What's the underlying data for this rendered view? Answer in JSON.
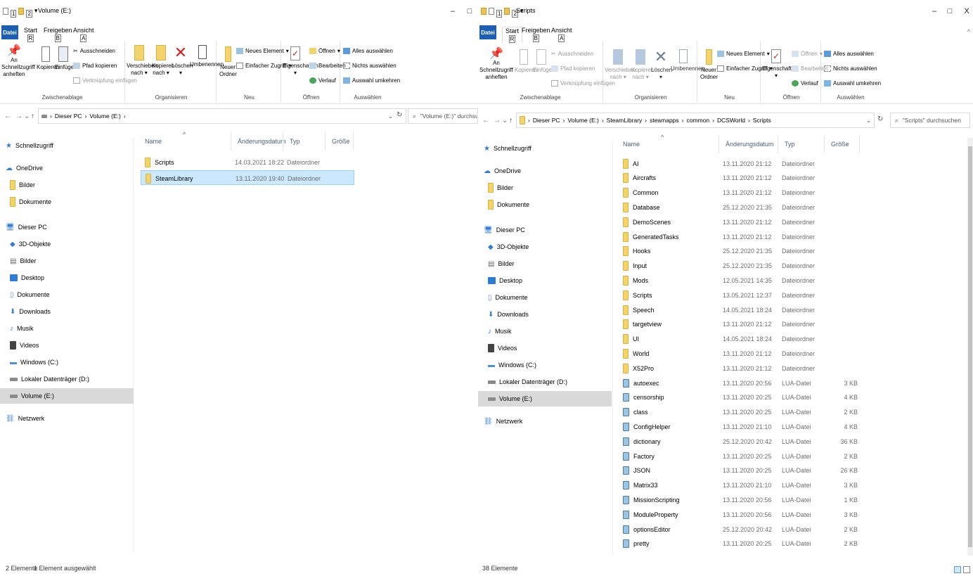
{
  "left": {
    "title": "Volume (E:)",
    "kt1": "1",
    "kt2": "2",
    "file_tab": "Datei",
    "tabs": [
      {
        "label": "Start",
        "key": "R"
      },
      {
        "label": "Freigeben",
        "key": "B"
      },
      {
        "label": "Ansicht",
        "key": "A"
      }
    ],
    "ribbon": {
      "pin": "An Schnellzugriff anheften",
      "copy": "Kopieren",
      "paste": "Einfügen",
      "cut": "Ausschneiden",
      "copy_path": "Pfad kopieren",
      "paste_link": "Verknüpfung einfügen",
      "g_clipboard": "Zwischenablage",
      "move": "Verschieben nach",
      "copyto": "Kopieren nach",
      "delete": "Löschen",
      "rename": "Umbenennen",
      "g_organize": "Organisieren",
      "new_folder": "Neuer Ordner",
      "new_item": "Neues Element",
      "easy_access": "Einfacher Zugriff",
      "g_new": "Neu",
      "properties": "Eigenschaften",
      "open": "Öffnen",
      "edit": "Bearbeiten",
      "history": "Verlauf",
      "g_open": "Öffnen",
      "select_all": "Alles auswählen",
      "select_none": "Nichts auswählen",
      "invert": "Auswahl umkehren",
      "g_select": "Auswählen"
    },
    "path": [
      "Dieser PC",
      "Volume (E:)"
    ],
    "search_placeholder": "\"Volume (E:)\" durchsuchen",
    "sidebar": [
      "Schnellzugriff",
      "OneDrive",
      "Bilder",
      "Dokumente",
      "Dieser PC",
      "3D-Objekte",
      "Bilder",
      "Desktop",
      "Dokumente",
      "Downloads",
      "Musik",
      "Videos",
      "Windows (C:)",
      "Lokaler Datenträger (D:)",
      "Volume (E:)",
      "Netzwerk"
    ],
    "columns": {
      "name": "Name",
      "date": "Änderungsdatum",
      "type": "Typ",
      "size": "Größe"
    },
    "rows": [
      {
        "name": "Scripts",
        "date": "14.03.2021 18:22",
        "type": "Dateiordner",
        "size": ""
      },
      {
        "name": "SteamLibrary",
        "date": "13.11.2020 19:40",
        "type": "Dateiordner",
        "size": ""
      }
    ],
    "status": "2 Elemente",
    "status_sel": "1 Element ausgewählt"
  },
  "right": {
    "title": "Scripts",
    "kt1": "1",
    "kt2": "2",
    "file_tab": "Datei",
    "tabs": [
      {
        "label": "Start",
        "key": "R"
      },
      {
        "label": "Freigeben",
        "key": "B"
      },
      {
        "label": "Ansicht",
        "key": "A"
      }
    ],
    "ribbon": {
      "pin": "An Schnellzugriff anheften",
      "copy": "Kopieren",
      "paste": "Einfügen",
      "cut": "Ausschneiden",
      "copy_path": "Pfad kopieren",
      "paste_link": "Verknüpfung einfügen",
      "g_clipboard": "Zwischenablage",
      "move": "Verschieben nach",
      "copyto": "Kopieren nach",
      "delete": "Löschen",
      "rename": "Umbenennen",
      "g_organize": "Organisieren",
      "new_folder": "Neuer Ordner",
      "new_item": "Neues Element",
      "easy_access": "Einfacher Zugriff",
      "g_new": "Neu",
      "properties": "Eigenschaften",
      "open": "Öffnen",
      "edit": "Bearbeiten",
      "history": "Verlauf",
      "g_open": "Öffnen",
      "select_all": "Alles auswählen",
      "select_none": "Nichts auswählen",
      "invert": "Auswahl umkehren",
      "g_select": "Auswählen"
    },
    "path": [
      "Dieser PC",
      "Volume (E:)",
      "SteamLibrary",
      "steamapps",
      "common",
      "DCSWorld",
      "Scripts"
    ],
    "search_placeholder": "\"Scripts\" durchsuchen",
    "sidebar": [
      "Schnellzugriff",
      "OneDrive",
      "Bilder",
      "Dokumente",
      "Dieser PC",
      "3D-Objekte",
      "Bilder",
      "Desktop",
      "Dokumente",
      "Downloads",
      "Musik",
      "Videos",
      "Windows (C:)",
      "Lokaler Datenträger (D:)",
      "Volume (E:)",
      "Netzwerk"
    ],
    "columns": {
      "name": "Name",
      "date": "Änderungsdatum",
      "type": "Typ",
      "size": "Größe"
    },
    "rows": [
      {
        "name": "AI",
        "date": "13.11.2020 21:12",
        "type": "Dateiordner",
        "size": "",
        "kind": "folder"
      },
      {
        "name": "Aircrafts",
        "date": "13.11.2020 21:12",
        "type": "Dateiordner",
        "size": "",
        "kind": "folder"
      },
      {
        "name": "Common",
        "date": "13.11.2020 21:12",
        "type": "Dateiordner",
        "size": "",
        "kind": "folder"
      },
      {
        "name": "Database",
        "date": "25.12.2020 21:35",
        "type": "Dateiordner",
        "size": "",
        "kind": "folder"
      },
      {
        "name": "DemoScenes",
        "date": "13.11.2020 21:12",
        "type": "Dateiordner",
        "size": "",
        "kind": "folder"
      },
      {
        "name": "GeneratedTasks",
        "date": "13.11.2020 21:12",
        "type": "Dateiordner",
        "size": "",
        "kind": "folder"
      },
      {
        "name": "Hooks",
        "date": "25.12.2020 21:35",
        "type": "Dateiordner",
        "size": "",
        "kind": "folder"
      },
      {
        "name": "Input",
        "date": "25.12.2020 21:35",
        "type": "Dateiordner",
        "size": "",
        "kind": "folder"
      },
      {
        "name": "Mods",
        "date": "12.05.2021 14:35",
        "type": "Dateiordner",
        "size": "",
        "kind": "folder"
      },
      {
        "name": "Scripts",
        "date": "13.05.2021 12:37",
        "type": "Dateiordner",
        "size": "",
        "kind": "folder"
      },
      {
        "name": "Speech",
        "date": "14.05.2021 18:24",
        "type": "Dateiordner",
        "size": "",
        "kind": "folder"
      },
      {
        "name": "targetview",
        "date": "13.11.2020 21:12",
        "type": "Dateiordner",
        "size": "",
        "kind": "folder"
      },
      {
        "name": "UI",
        "date": "14.05.2021 18:24",
        "type": "Dateiordner",
        "size": "",
        "kind": "folder"
      },
      {
        "name": "World",
        "date": "13.11.2020 21:12",
        "type": "Dateiordner",
        "size": "",
        "kind": "folder"
      },
      {
        "name": "X52Pro",
        "date": "13.11.2020 21:12",
        "type": "Dateiordner",
        "size": "",
        "kind": "folder"
      },
      {
        "name": "autoexec",
        "date": "13.11.2020 20:56",
        "type": "LUA-Datei",
        "size": "3 KB",
        "kind": "lua"
      },
      {
        "name": "censorship",
        "date": "13.11.2020 20:25",
        "type": "LUA-Datei",
        "size": "4 KB",
        "kind": "lua"
      },
      {
        "name": "class",
        "date": "13.11.2020 20:25",
        "type": "LUA-Datei",
        "size": "2 KB",
        "kind": "lua"
      },
      {
        "name": "ConfigHelper",
        "date": "13.11.2020 21:10",
        "type": "LUA-Datei",
        "size": "4 KB",
        "kind": "lua"
      },
      {
        "name": "dictionary",
        "date": "25.12.2020 20:42",
        "type": "LUA-Datei",
        "size": "36 KB",
        "kind": "lua"
      },
      {
        "name": "Factory",
        "date": "13.11.2020 20:25",
        "type": "LUA-Datei",
        "size": "2 KB",
        "kind": "lua"
      },
      {
        "name": "JSON",
        "date": "13.11.2020 20:25",
        "type": "LUA-Datei",
        "size": "26 KB",
        "kind": "lua"
      },
      {
        "name": "Matrix33",
        "date": "13.11.2020 21:10",
        "type": "LUA-Datei",
        "size": "3 KB",
        "kind": "lua"
      },
      {
        "name": "MissionScripting",
        "date": "13.11.2020 20:56",
        "type": "LUA-Datei",
        "size": "1 KB",
        "kind": "lua"
      },
      {
        "name": "ModuleProperty",
        "date": "13.11.2020 20:56",
        "type": "LUA-Datei",
        "size": "3 KB",
        "kind": "lua"
      },
      {
        "name": "optionsEditor",
        "date": "25.12.2020 20:42",
        "type": "LUA-Datei",
        "size": "2 KB",
        "kind": "lua"
      },
      {
        "name": "pretty",
        "date": "13.11.2020 20:25",
        "type": "LUA-Datei",
        "size": "2 KB",
        "kind": "lua"
      }
    ],
    "status": "38 Elemente"
  }
}
